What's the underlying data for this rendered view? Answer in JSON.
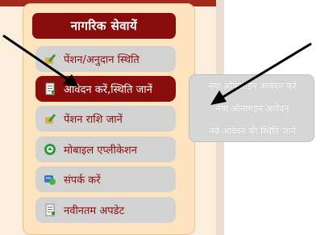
{
  "panel": {
    "title": "नागरिक सेवायें"
  },
  "menu": {
    "items": [
      {
        "label": "पेंशन/अनुदान स्थिति",
        "icon": "pencil-icon"
      },
      {
        "label": "आवेदन करें,स्थिति जानें",
        "icon": "document-icon",
        "active": true
      },
      {
        "label": "पेंशन राशि जानें",
        "icon": "pencil-icon"
      },
      {
        "label": "मोबाइल एप्लीकेशन",
        "icon": "android-icon"
      },
      {
        "label": "संपर्क करें",
        "icon": "contact-icon"
      },
      {
        "label": "नवीनतम अपडेट",
        "icon": "document-icon"
      }
    ]
  },
  "submenu": {
    "items": [
      {
        "label": "नया ऑफलाइन आवेदन करें"
      },
      {
        "label": "नया ऑनलाइन आवेदन"
      },
      {
        "label": "नये आवेदन की स्थिति जानें"
      }
    ]
  },
  "colors": {
    "title_bg": "#8a0d0d",
    "panel_bg": "#fde4bf",
    "item_bg": "#d2d2d2",
    "item_text": "#8a0d0d",
    "popup_bg": "#d6d6d6",
    "arrow": "#000000"
  }
}
